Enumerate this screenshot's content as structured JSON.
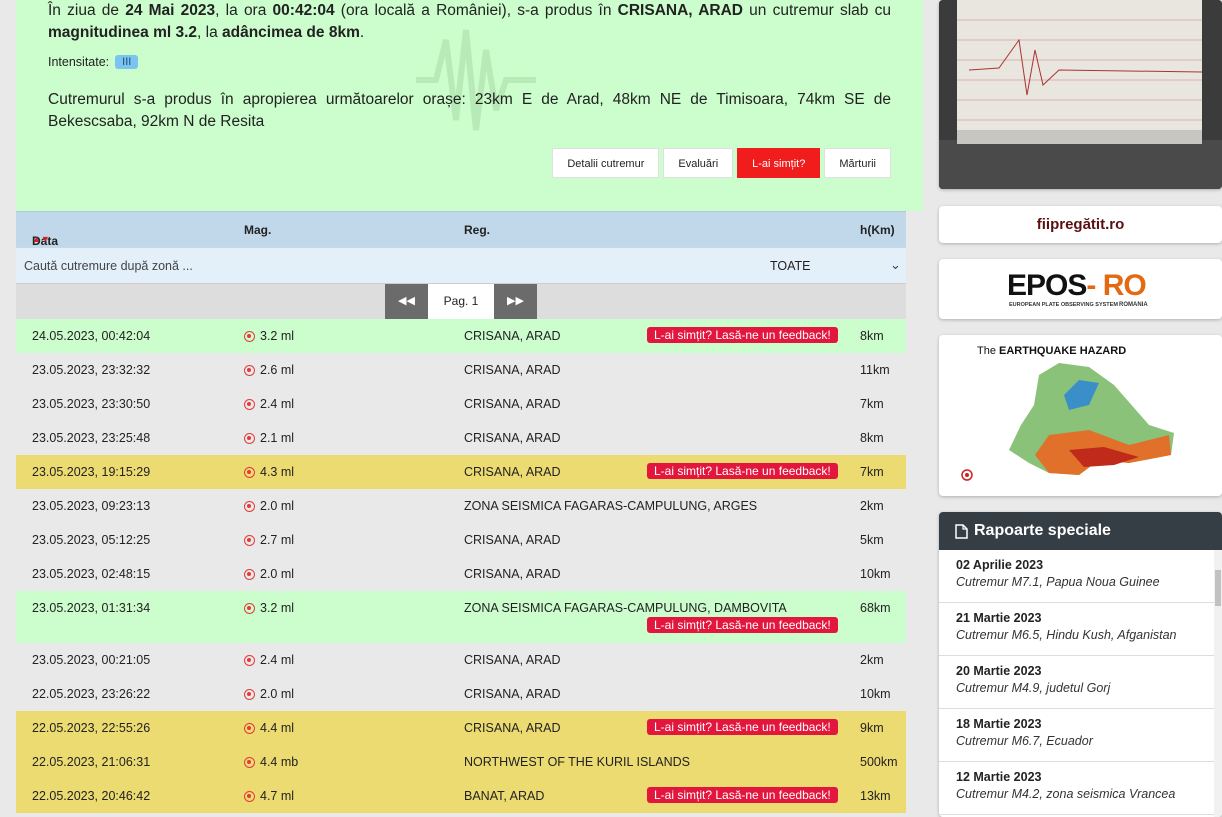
{
  "info": {
    "p1_a": "În ziua de ",
    "p1_date": "24 Mai 2023",
    "p1_b": ", la ora ",
    "p1_time": "00:42:04",
    "p1_c": " (ora locală a României), s-a produs în ",
    "p1_region": "CRISANA, ARAD",
    "p1_d": " un cutremur slab cu ",
    "p1_mag": "magnitudinea ml 3.2",
    "p1_e": ", la ",
    "p1_depth": "adâncimea de 8km",
    "p1_f": ".",
    "intensity_label": "Intensitate:",
    "intensity_value": "III",
    "p2": "Cutremurul s-a produs în apropierea următoarelor orașe: 23km E de Arad, 48km NE de Timisoara, 74km SE de Bekescsaba, 92km N de Resita",
    "buttons": {
      "details": "Detalii cutremur",
      "evaluations": "Evaluări",
      "felt": "L-ai simțit?",
      "testimonies": "Mărturii"
    }
  },
  "table": {
    "headers": {
      "date": "Data",
      "mag": "Mag.",
      "reg": "Reg.",
      "depth": "h(Km)"
    },
    "filter_placeholder": "Caută cutremure după zonă ...",
    "filter_select": "TOATE",
    "page_label": "Pag. 1",
    "feedback_label": "L-ai simțit? Lasă-ne un feedback!",
    "rows": [
      {
        "date": "24.05.2023, 00:42:04",
        "mag": "3.2 ml",
        "reg": "CRISANA, ARAD",
        "depth": "8km",
        "color": "green",
        "feedback": true
      },
      {
        "date": "23.05.2023, 23:32:32",
        "mag": "2.6 ml",
        "reg": "CRISANA, ARAD",
        "depth": "11km",
        "color": "grey",
        "feedback": false
      },
      {
        "date": "23.05.2023, 23:30:50",
        "mag": "2.4 ml",
        "reg": "CRISANA, ARAD",
        "depth": "7km",
        "color": "grey",
        "feedback": false
      },
      {
        "date": "23.05.2023, 23:25:48",
        "mag": "2.1 ml",
        "reg": "CRISANA, ARAD",
        "depth": "8km",
        "color": "grey",
        "feedback": false
      },
      {
        "date": "23.05.2023, 19:15:29",
        "mag": "4.3 ml",
        "reg": "CRISANA, ARAD",
        "depth": "7km",
        "color": "yellow",
        "feedback": true
      },
      {
        "date": "23.05.2023, 09:23:13",
        "mag": "2.0 ml",
        "reg": "ZONA SEISMICA FAGARAS-CAMPULUNG, ARGES",
        "depth": "2km",
        "color": "grey",
        "feedback": false
      },
      {
        "date": "23.05.2023, 05:12:25",
        "mag": "2.7 ml",
        "reg": "CRISANA, ARAD",
        "depth": "5km",
        "color": "grey",
        "feedback": false
      },
      {
        "date": "23.05.2023, 02:48:15",
        "mag": "2.0 ml",
        "reg": "CRISANA, ARAD",
        "depth": "10km",
        "color": "grey",
        "feedback": false
      },
      {
        "date": "23.05.2023, 01:31:34",
        "mag": "3.2 ml",
        "reg": "ZONA SEISMICA FAGARAS-CAMPULUNG, DAMBOVITA",
        "depth": "68km",
        "color": "green",
        "feedback": true,
        "tall": true
      },
      {
        "date": "23.05.2023, 00:21:05",
        "mag": "2.4 ml",
        "reg": "CRISANA, ARAD",
        "depth": "2km",
        "color": "grey",
        "feedback": false
      },
      {
        "date": "22.05.2023, 23:26:22",
        "mag": "2.0 ml",
        "reg": "CRISANA, ARAD",
        "depth": "10km",
        "color": "grey",
        "feedback": false
      },
      {
        "date": "22.05.2023, 22:55:26",
        "mag": "4.4 ml",
        "reg": "CRISANA, ARAD",
        "depth": "9km",
        "color": "yellow",
        "feedback": true
      },
      {
        "date": "22.05.2023, 21:06:31",
        "mag": "4.4 mb",
        "reg": "NORTHWEST OF THE KURIL ISLANDS",
        "depth": "500km",
        "color": "yellow",
        "feedback": false
      },
      {
        "date": "22.05.2023, 20:46:42",
        "mag": "4.7 ml",
        "reg": "BANAT, ARAD",
        "depth": "13km",
        "color": "yellow",
        "feedback": true
      }
    ]
  },
  "sidebar": {
    "fii": "fiipregătit.ro",
    "epos_main": "EPOS",
    "epos_ro": "- RO",
    "epos_sub": "EUROPEAN PLATE OBSERVING SYSTEM",
    "epos_country": "ROMANIA",
    "hazard_the": "The",
    "hazard_title": "EARTHQUAKE HAZARD",
    "reports_title": "Rapoarte speciale",
    "reports": [
      {
        "date": "02 Aprilie 2023",
        "text": "Cutremur M7.1, Papua Noua Guinee"
      },
      {
        "date": "21 Martie 2023",
        "text": "Cutremur M6.5, Hindu Kush, Afganistan"
      },
      {
        "date": "20 Martie 2023",
        "text": "Cutremur M4.9, judetul Gorj"
      },
      {
        "date": "18 Martie 2023",
        "text": "Cutremur M6.7, Ecuador"
      },
      {
        "date": "12 Martie 2023",
        "text": "Cutremur M4.2, zona seismica Vrancea"
      }
    ]
  }
}
